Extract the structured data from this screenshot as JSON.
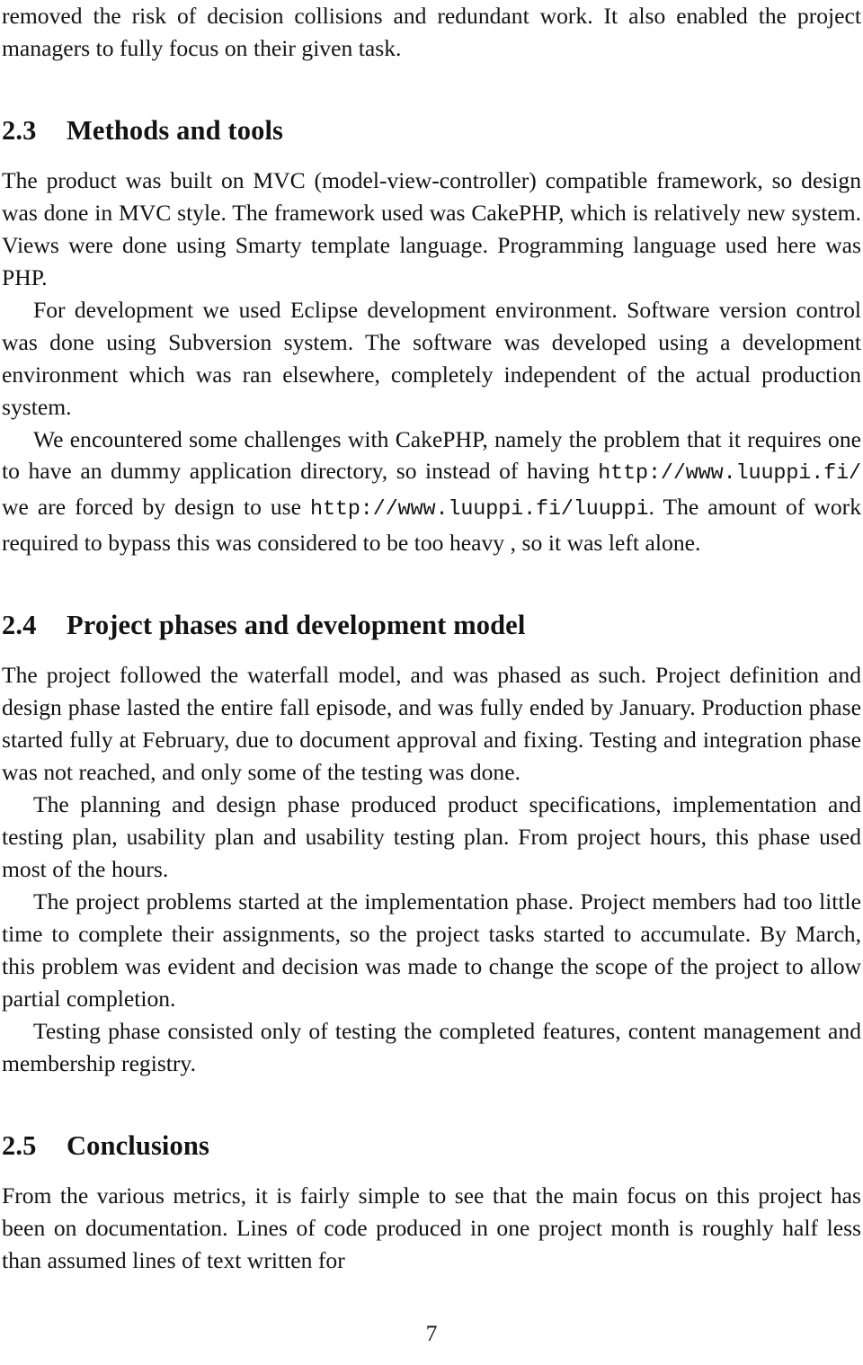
{
  "document": {
    "page_number": "7",
    "body_text_color": "#131313",
    "background_color": "#ffffff"
  },
  "top_paragraph": {
    "text": "removed the risk of decision collisions and redundant work. It also enabled the project managers to fully focus on their given task."
  },
  "sections": [
    {
      "id": "methods-and-tools",
      "number": "2.3",
      "title": "Methods and tools",
      "paragraphs": [
        {
          "id": "mvc-framework",
          "indent": false,
          "parts": [
            {
              "type": "text",
              "value": "The product was built on MVC (model-view-controller) compatible framework, so design was done in MVC style. The framework used was CakePHP, which is relatively new system. Views were done using Smarty template language. Programming language used here was PHP."
            }
          ]
        },
        {
          "id": "development-environment",
          "indent": true,
          "parts": [
            {
              "type": "text",
              "value": "For development we used Eclipse development environment. Software version control was done using Subversion system. The software was developed using a development environment which was ran elsewhere, completely independent of the actual production system."
            }
          ]
        },
        {
          "id": "cakephp-challenges",
          "indent": true,
          "parts": [
            {
              "type": "text",
              "value": "We encountered some challenges with CakePHP, namely the problem that it requires one to have an dummy application directory, so instead of having "
            },
            {
              "type": "code",
              "value": "http://www.luuppi.fi/"
            },
            {
              "type": "text",
              "value": " we are forced by design to use "
            },
            {
              "type": "code",
              "value": "http://www.luuppi.fi/luuppi"
            },
            {
              "type": "text",
              "value": ". The amount of work required to bypass this was considered to be too heavy , so it was left alone."
            }
          ]
        }
      ]
    },
    {
      "id": "project-phases-and-development-model",
      "number": "2.4",
      "title": "Project phases and development model",
      "paragraphs": [
        {
          "id": "waterfall-model",
          "indent": false,
          "parts": [
            {
              "type": "text",
              "value": "The project followed the waterfall model, and was phased as such. Project definition and design phase lasted the entire fall episode, and was fully ended by January. Production phase started fully at February, due to document approval and fixing. Testing and integration phase was not reached, and only some of the testing was done."
            }
          ]
        },
        {
          "id": "planning-and-design-phase",
          "indent": true,
          "parts": [
            {
              "type": "text",
              "value": "The planning and design phase produced product specifications, implementation and testing plan, usability plan and usability testing plan. From project hours, this phase used most of the hours."
            }
          ]
        },
        {
          "id": "implementation-problems",
          "indent": true,
          "parts": [
            {
              "type": "text",
              "value": "The project problems started at the implementation phase. Project members had too little time to complete their assignments, so the project tasks started to accumulate. By March, this problem was evident and decision was made to change the scope of the project to allow partial completion."
            }
          ]
        },
        {
          "id": "testing-phase",
          "indent": true,
          "parts": [
            {
              "type": "text",
              "value": "Testing phase consisted only of testing the completed features, content management and membership registry."
            }
          ]
        }
      ]
    },
    {
      "id": "conclusions",
      "number": "2.5",
      "title": "Conclusions",
      "paragraphs": [
        {
          "id": "metrics-focus",
          "indent": false,
          "parts": [
            {
              "type": "text",
              "value": "From the various metrics, it is fairly simple to see that the main focus on this project has been on documentation. Lines of code produced in one project month is roughly half less than assumed lines of text written for"
            }
          ]
        }
      ]
    }
  ]
}
